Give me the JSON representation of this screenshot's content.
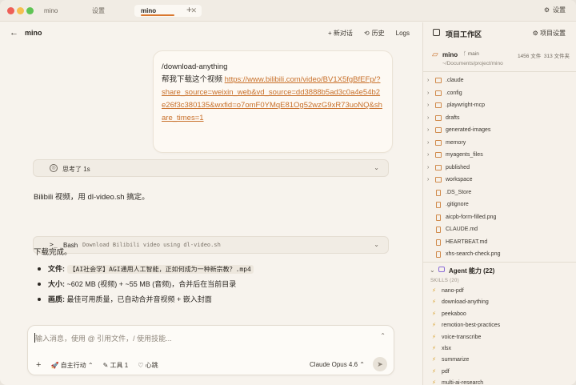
{
  "tabs": [
    {
      "label": "mino",
      "active": false
    },
    {
      "label": "设置",
      "active": false
    },
    {
      "label": "mino",
      "active": true
    }
  ],
  "titlebar": {
    "settings_label": "设置",
    "add_tab": "+"
  },
  "chat": {
    "back": "←",
    "title": "mino",
    "new_chat": "+ 新对话",
    "history": "历史",
    "logs": "Logs"
  },
  "user_message": {
    "command": "/download-anything",
    "text": "帮我下载这个视频 ",
    "link": "https://www.bilibili.com/video/BV1X5fgBfEFp/?share_source=weixin_web&vd_source=dd3888b5ad3c0a4e54b2e26f3c380135&wxfid=o7omF0YMqE81Og52wzG9xR73uoNQ&share_times=1"
  },
  "thinking": {
    "label": "思考了 1s"
  },
  "reply1": "Bilibili 视频，用 dl-video.sh 搞定。",
  "bash": {
    "label": "Bash",
    "desc": "Download Bilibili video using dl-video.sh"
  },
  "reply2": "下载完成。",
  "details": [
    {
      "key": "文件:",
      "value": "【AI社会学】AGI通用人工智能，正如何成为一种新宗教？.mp4",
      "code": true
    },
    {
      "key": "大小:",
      "value": "~602 MB (视频) + ~55 MB (音频)，合并后在当前目录",
      "code": false
    },
    {
      "key": "画质:",
      "value": "最佳可用质量，已自动合并音视频 + 嵌入封面",
      "code": false
    }
  ],
  "composer": {
    "placeholder": "输入消息，使用 @ 引用文件，/ 使用技能...",
    "mode": "自主行动",
    "tools": "工具 1",
    "heartbeat": "心跳",
    "model": "Claude Opus 4.6"
  },
  "panel": {
    "title": "项目工作区",
    "settings": "项目设置",
    "project_name": "mino",
    "branch": "main",
    "path": "~/Documents/project/mino",
    "file_count": "1456 文件",
    "dir_count": "313 文件夹",
    "files": [
      {
        "name": ".claude",
        "type": "folder"
      },
      {
        "name": ".config",
        "type": "folder"
      },
      {
        "name": ".playwright-mcp",
        "type": "folder"
      },
      {
        "name": "drafts",
        "type": "folder"
      },
      {
        "name": "generated-images",
        "type": "folder"
      },
      {
        "name": "memory",
        "type": "folder"
      },
      {
        "name": "myagents_files",
        "type": "folder"
      },
      {
        "name": "published",
        "type": "folder"
      },
      {
        "name": "workspace",
        "type": "folder"
      },
      {
        "name": ".DS_Store",
        "type": "file"
      },
      {
        "name": ".gitignore",
        "type": "file"
      },
      {
        "name": "aicpb-form-filled.png",
        "type": "file"
      },
      {
        "name": "CLAUDE.md",
        "type": "file"
      },
      {
        "name": "HEARTBEAT.md",
        "type": "file"
      },
      {
        "name": "xhs-search-check.png",
        "type": "file"
      }
    ],
    "agent_label": "Agent 能力 (22)",
    "skills_label": "SKILLS (20)",
    "skills": [
      "nano-pdf",
      "download-anything",
      "peekaboo",
      "remotion-best-practices",
      "voice-transcribe",
      "xlsx",
      "summarize",
      "pdf",
      "multi-ai-research"
    ]
  }
}
